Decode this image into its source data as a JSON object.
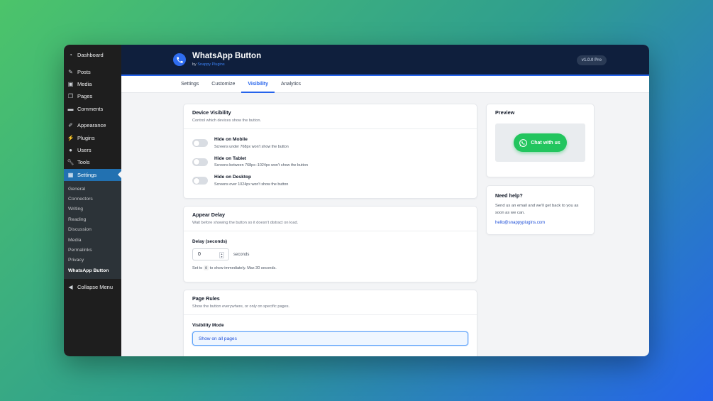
{
  "sidebar": {
    "items": [
      {
        "label": "Dashboard",
        "icon": "dashboard-icon"
      },
      {
        "label": "Posts",
        "icon": "pin-icon"
      },
      {
        "label": "Media",
        "icon": "media-icon"
      },
      {
        "label": "Pages",
        "icon": "pages-icon"
      },
      {
        "label": "Comments",
        "icon": "comment-icon"
      },
      {
        "label": "Appearance",
        "icon": "brush-icon"
      },
      {
        "label": "Plugins",
        "icon": "plug-icon"
      },
      {
        "label": "Users",
        "icon": "user-icon"
      },
      {
        "label": "Tools",
        "icon": "wrench-icon"
      },
      {
        "label": "Settings",
        "icon": "settings-icon"
      }
    ],
    "submenu": [
      "General",
      "Connectors",
      "Writing",
      "Reading",
      "Discussion",
      "Media",
      "Permalinks",
      "Privacy",
      "WhatsApp Button"
    ],
    "collapse_label": "Collapse Menu"
  },
  "header": {
    "title": "WhatsApp Button",
    "by": "by",
    "author": "Snappy Plugins",
    "version": "v1.0.0 Pro"
  },
  "tabs": [
    "Settings",
    "Customize",
    "Visibility",
    "Analytics"
  ],
  "device_visibility": {
    "title": "Device Visibility",
    "desc": "Control which devices show the button.",
    "toggles": [
      {
        "label": "Hide on Mobile",
        "desc": "Screens under 768px won't show the button",
        "on": false
      },
      {
        "label": "Hide on Tablet",
        "desc": "Screens between 768px–1024px won't show the button",
        "on": false
      },
      {
        "label": "Hide on Desktop",
        "desc": "Screens over 1024px won't show the button",
        "on": false
      }
    ]
  },
  "appear_delay": {
    "title": "Appear Delay",
    "desc": "Wait before showing the button so it doesn't distract on load.",
    "field_label": "Delay (seconds)",
    "value": "0",
    "unit": "seconds",
    "hint_pre": "Set to",
    "hint_code": "0",
    "hint_post": "to show immediately. Max 30 seconds."
  },
  "page_rules": {
    "title": "Page Rules",
    "desc": "Show the button everywhere, or only on specific pages.",
    "field_label": "Visibility Mode",
    "selected": "Show on all pages"
  },
  "preview": {
    "title": "Preview",
    "button_label": "Chat with us"
  },
  "help": {
    "title": "Need help?",
    "text": "Send us an email and we'll get back to you as soon as we can.",
    "email": "hello@snappyplugins.com"
  },
  "colors": {
    "accent": "#2563eb",
    "whatsapp_green": "#22c55e",
    "header_bg": "#0f1f3d",
    "sidebar_bg": "#1e1e1e",
    "active_menu": "#2271b1"
  }
}
